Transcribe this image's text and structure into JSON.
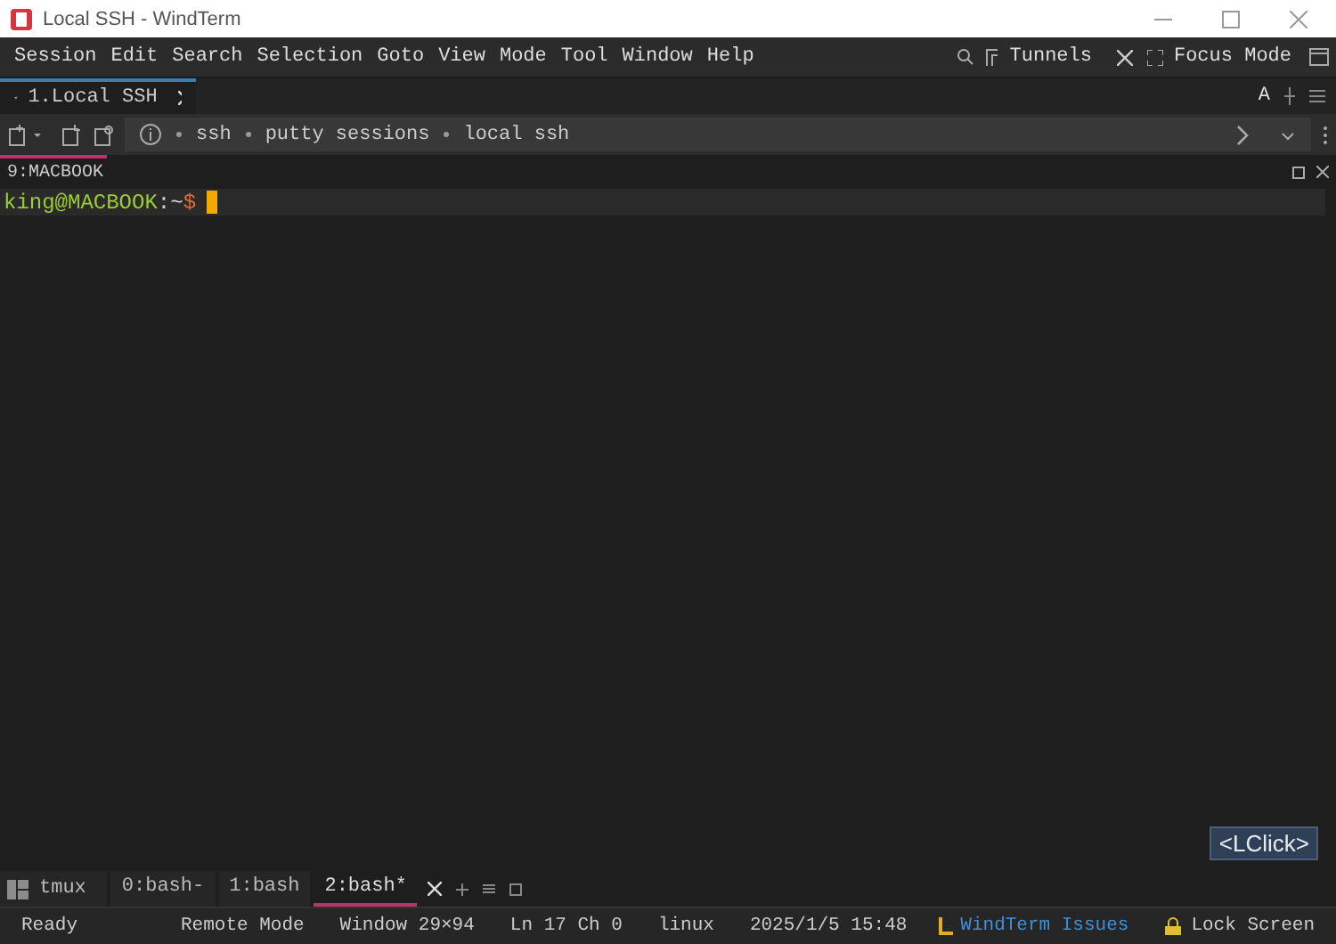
{
  "window": {
    "title": "Local SSH - WindTerm"
  },
  "menu": [
    "Session",
    "Edit",
    "Search",
    "Selection",
    "Goto",
    "View",
    "Mode",
    "Tool",
    "Window",
    "Help"
  ],
  "menu_right": {
    "tunnels": "Tunnels",
    "focus_mode": "Focus Mode"
  },
  "tabs": [
    {
      "label": "1.Local SSH",
      "selected": true
    }
  ],
  "tab_bar_right": "A",
  "breadcrumb": [
    "ssh",
    "putty sessions",
    "local ssh"
  ],
  "pane": {
    "title": "9:MACBOOK"
  },
  "terminal": {
    "user": "king@MACBOOK",
    "path": ":~",
    "symbol": "$"
  },
  "overlay": "<LClick>",
  "tmux": {
    "label": "tmux",
    "windows": [
      {
        "label": "0:bash-",
        "selected": false
      },
      {
        "label": "1:bash",
        "selected": false
      },
      {
        "label": "2:bash*",
        "selected": true
      }
    ]
  },
  "status": {
    "left": "Ready",
    "items": [
      "Remote Mode",
      "Window 29×94",
      "Ln 17 Ch 0",
      "linux",
      "2025/1/5 15:48"
    ],
    "link": "WindTerm Issues",
    "lock": "Lock Screen"
  }
}
